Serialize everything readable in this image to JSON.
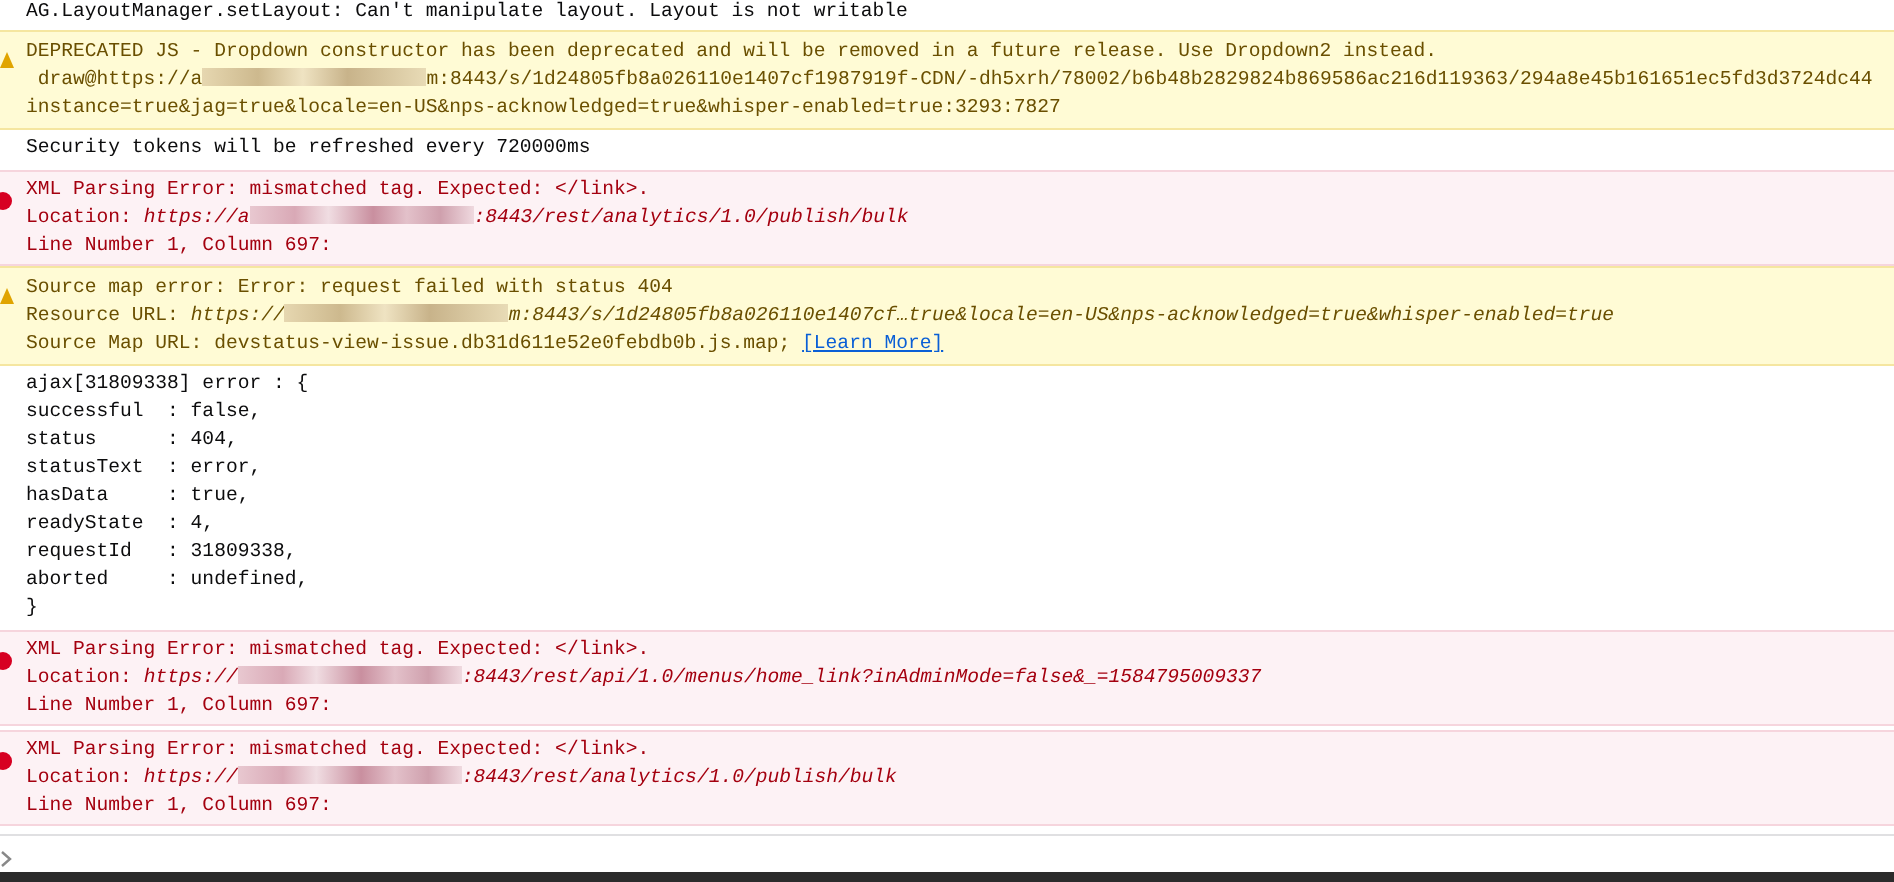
{
  "messages": [
    {
      "kind": "log",
      "lines": [
        {
          "kind": "text",
          "text": "AG.LayoutManager.setLayout: Can't manipulate layout. Layout is not writable"
        }
      ]
    },
    {
      "kind": "warning",
      "lines": [
        {
          "kind": "text",
          "text": "DEPRECATED JS - Dropdown constructor has been deprecated and will be removed in a future release. Use Dropdown2 instead."
        },
        {
          "kind": "url",
          "italic": false,
          "url_start": " draw@https://a",
          "url_end": "m:8443/s/1d24805fb8a026110e1407cf1987919f-CDN/-dh5xrh/78002/b6b48b2829824b869586ac216d119363/294a8e45b161651ec5fd3d3724dc44"
        },
        {
          "kind": "text",
          "text": "instance=true&jag=true&locale=en-US&nps-acknowledged=true&whisper-enabled=true:3293:7827"
        }
      ]
    },
    {
      "kind": "log",
      "lines": [
        {
          "kind": "text",
          "text": "Security tokens will be refreshed every 720000ms"
        }
      ]
    },
    {
      "kind": "error",
      "lines": [
        {
          "kind": "text",
          "text": "XML Parsing Error: mismatched tag. Expected: </link>."
        },
        {
          "kind": "url",
          "italic": true,
          "label": "Location:",
          "url_start": "https://a",
          "url_end": ":8443/rest/analytics/1.0/publish/bulk"
        },
        {
          "kind": "text",
          "text": "Line Number 1, Column 697:"
        }
      ]
    },
    {
      "kind": "warning",
      "lines": [
        {
          "kind": "text",
          "text": "Source map error: Error: request failed with status 404"
        },
        {
          "kind": "url",
          "italic": true,
          "label": "Resource URL:",
          "url_start": "https://",
          "url_end": "m:8443/s/1d24805fb8a026110e1407cf…true&locale=en-US&nps-acknowledged=true&whisper-enabled=true"
        },
        {
          "kind": "link",
          "text": "Source Map URL: devstatus-view-issue.db31d611e52e0febdb0b.js.map;",
          "link": "[Learn More]"
        }
      ]
    },
    {
      "kind": "log",
      "lines": [
        {
          "kind": "text",
          "text": "ajax[31809338] error : {"
        },
        {
          "kind": "text",
          "text": "successful  : false,"
        },
        {
          "kind": "text",
          "text": "status      : 404,"
        },
        {
          "kind": "text",
          "text": "statusText  : error,"
        },
        {
          "kind": "text",
          "text": "hasData     : true,"
        },
        {
          "kind": "text",
          "text": "readyState  : 4,"
        },
        {
          "kind": "text",
          "text": "requestId   : 31809338,"
        },
        {
          "kind": "text",
          "text": "aborted     : undefined,"
        },
        {
          "kind": "text",
          "text": "}"
        }
      ]
    },
    {
      "kind": "error",
      "lines": [
        {
          "kind": "text",
          "text": "XML Parsing Error: mismatched tag. Expected: </link>."
        },
        {
          "kind": "url",
          "italic": true,
          "label": "Location:",
          "url_start": "https://",
          "url_end": ":8443/rest/api/1.0/menus/home_link?inAdminMode=false&_=1584795009337"
        },
        {
          "kind": "text",
          "text": "Line Number 1, Column 697:"
        }
      ]
    },
    {
      "kind": "error",
      "lines": [
        {
          "kind": "text",
          "text": "XML Parsing Error: mismatched tag. Expected: </link>."
        },
        {
          "kind": "url",
          "italic": true,
          "label": "Location:",
          "url_start": "https://",
          "url_end": ":8443/rest/analytics/1.0/publish/bulk"
        },
        {
          "kind": "text",
          "text": "Line Number 1, Column 697:"
        }
      ]
    }
  ]
}
